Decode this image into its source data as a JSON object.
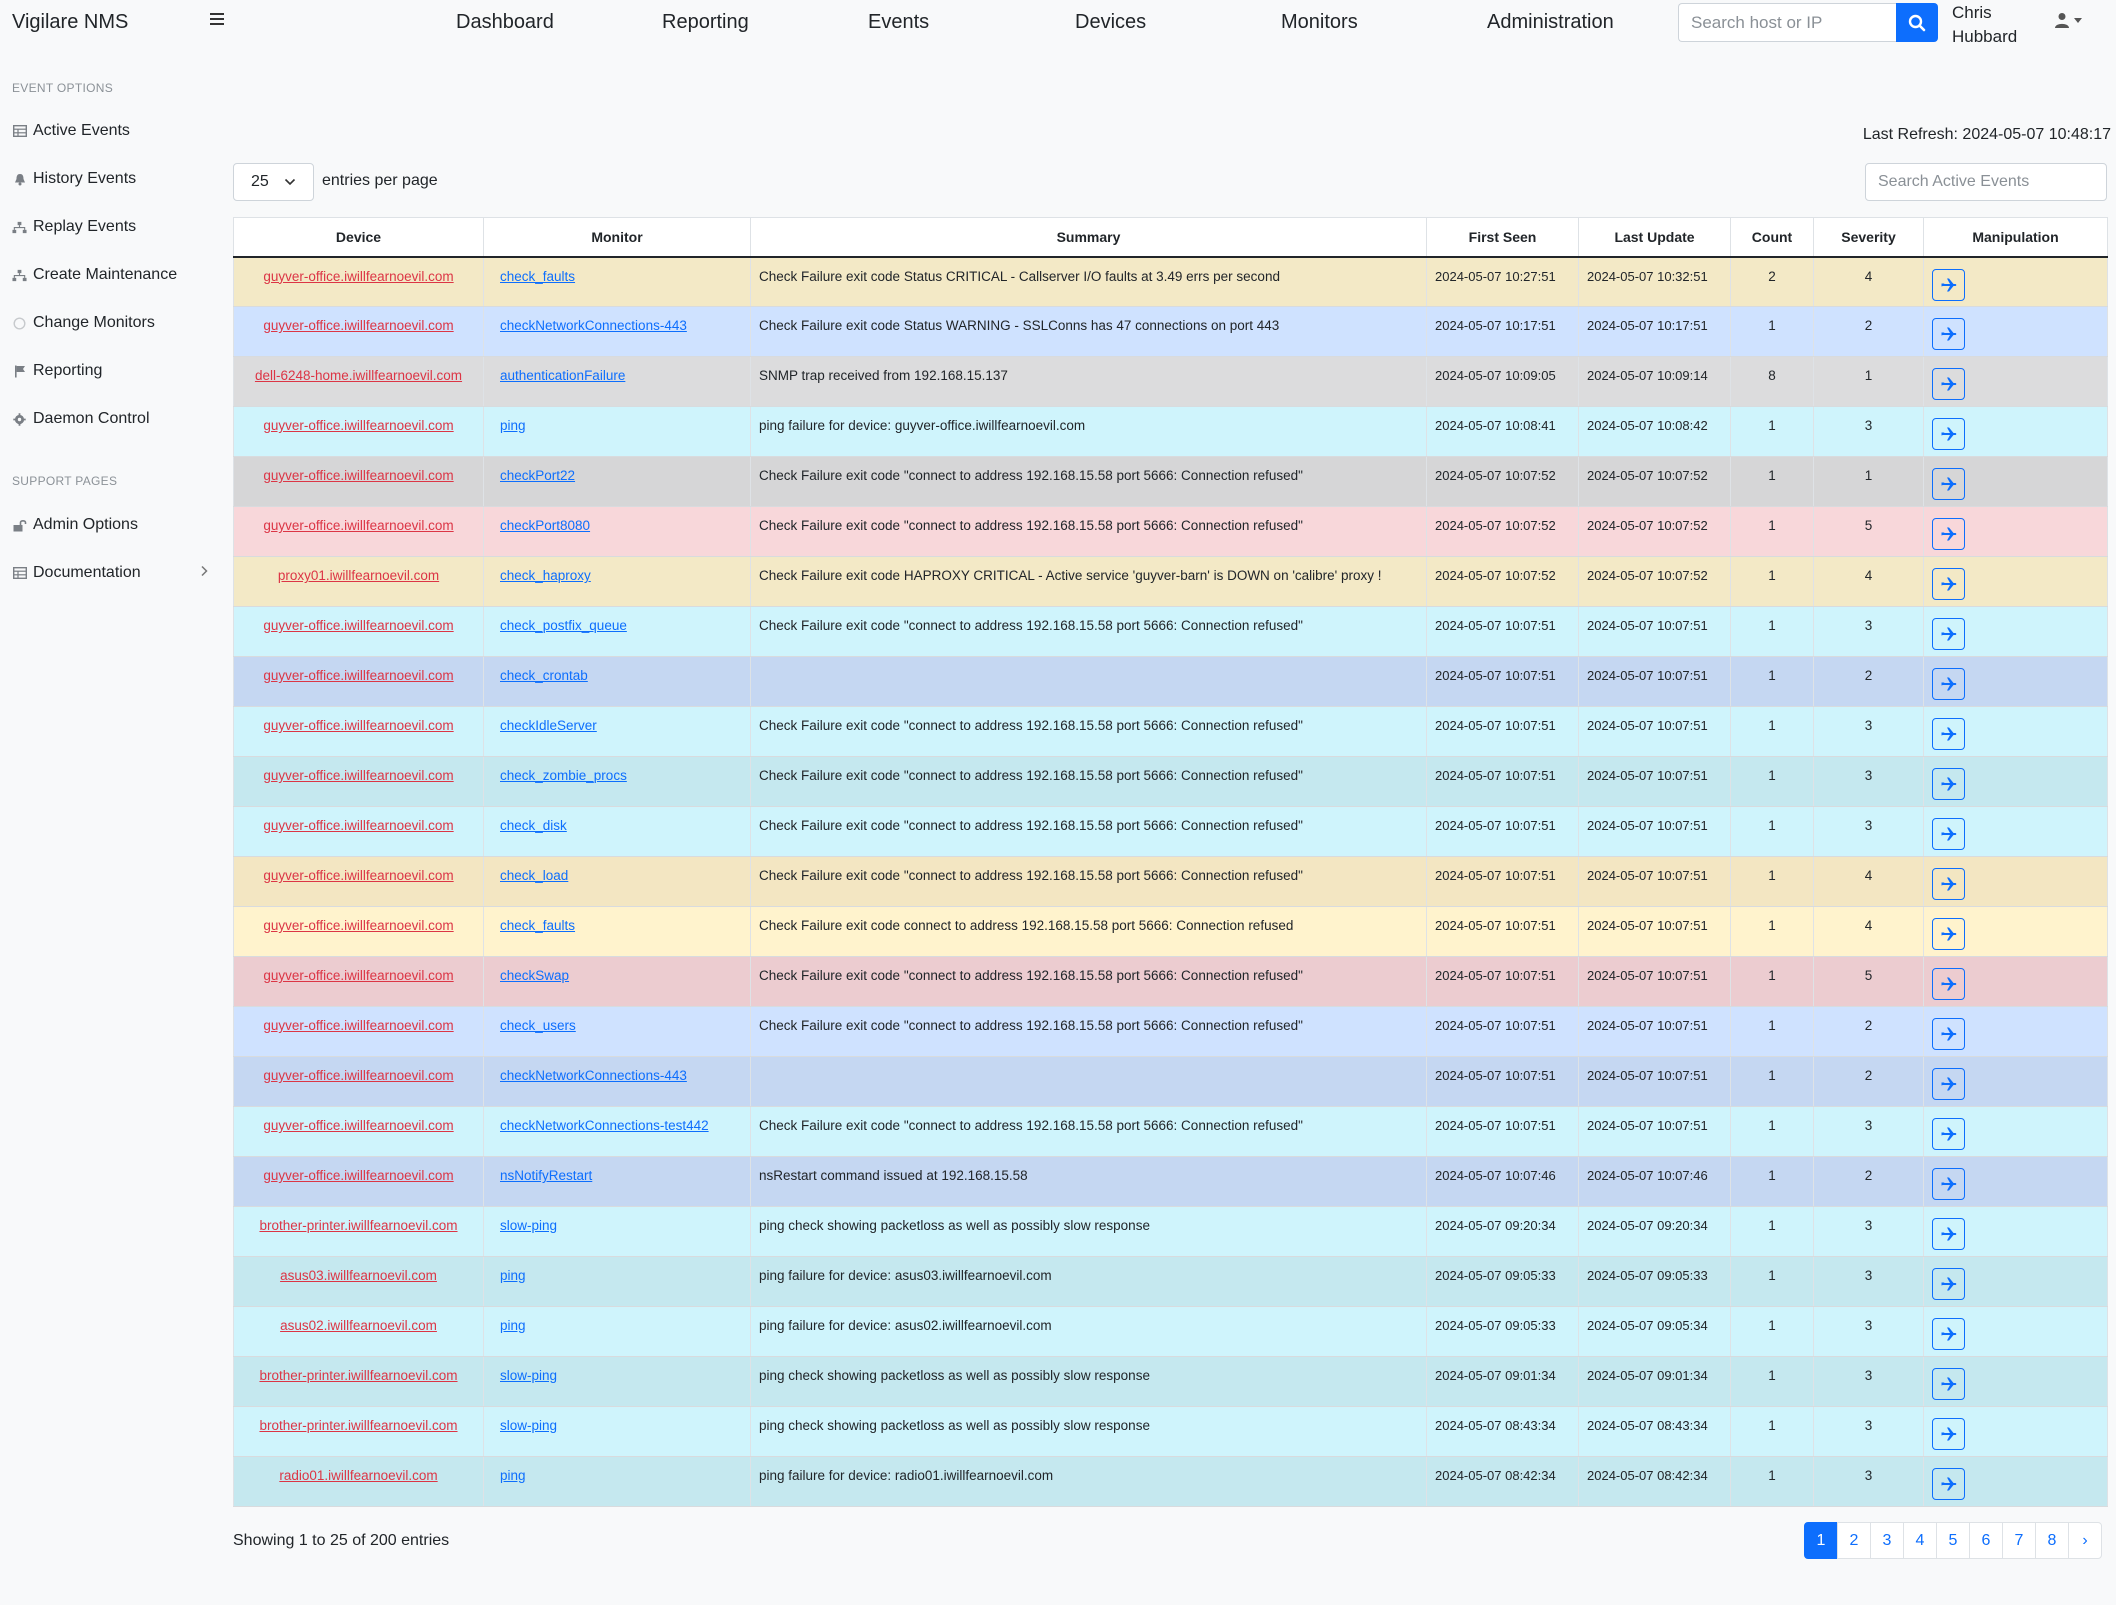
{
  "app": {
    "title": "Vigilare NMS"
  },
  "nav": {
    "items": [
      "Dashboard",
      "Reporting",
      "Events",
      "Devices",
      "Monitors",
      "Administration"
    ],
    "search_placeholder": "Search host or IP",
    "user_name_line1": "Chris",
    "user_name_line2": "Hubbard"
  },
  "sidebar": {
    "event_heading": "EVENT OPTIONS",
    "event_items": [
      {
        "label": "Active Events",
        "icon": "table-icon"
      },
      {
        "label": "History Events",
        "icon": "bell-icon"
      },
      {
        "label": "Replay Events",
        "icon": "sitemap-icon"
      },
      {
        "label": "Create Maintenance",
        "icon": "sitemap-icon"
      },
      {
        "label": "Change Monitors",
        "icon": "circle-icon"
      },
      {
        "label": "Reporting",
        "icon": "flag-icon"
      },
      {
        "label": "Daemon Control",
        "icon": "gear-icon"
      }
    ],
    "support_heading": "SUPPORT PAGES",
    "support_items": [
      {
        "label": "Admin Options",
        "icon": "unlock-icon"
      },
      {
        "label": "Documentation",
        "icon": "table-icon"
      }
    ]
  },
  "main": {
    "last_refresh": "Last Refresh: 2024-05-07 10:48:17",
    "entries_value": "25",
    "entries_label": "entries per page",
    "search_placeholder": "Search Active Events",
    "columns": [
      "Device",
      "Monitor",
      "Summary",
      "First Seen",
      "Last Update",
      "Count",
      "Severity",
      "Manipulation"
    ],
    "rows": [
      {
        "device": "guyver-office.iwillfearnoevil.com",
        "monitor": "check_faults",
        "summary": "Check Failure exit code Status CRITICAL - Callserver I/O faults at 3.49 errs per second",
        "first": "2024-05-07 10:27:51",
        "last": "2024-05-07 10:32:51",
        "count": "2",
        "severity": "4",
        "bg": "#f3e9c6"
      },
      {
        "device": "guyver-office.iwillfearnoevil.com",
        "monitor": "checkNetworkConnections-443",
        "summary": "Check Failure exit code Status WARNING - SSLConns has 47 connections on port 443",
        "first": "2024-05-07 10:17:51",
        "last": "2024-05-07 10:17:51",
        "count": "1",
        "severity": "2",
        "bg": "#cfe2ff"
      },
      {
        "device": "dell-6248-home.iwillfearnoevil.com",
        "monitor": "authenticationFailure",
        "summary": "SNMP trap received from 192.168.15.137",
        "first": "2024-05-07 10:09:05",
        "last": "2024-05-07 10:09:14",
        "count": "8",
        "severity": "1",
        "bg": "#dcdcdd"
      },
      {
        "device": "guyver-office.iwillfearnoevil.com",
        "monitor": "ping",
        "summary": "ping failure for device: guyver-office.iwillfearnoevil.com",
        "first": "2024-05-07 10:08:41",
        "last": "2024-05-07 10:08:42",
        "count": "1",
        "severity": "3",
        "bg": "#cff4fc"
      },
      {
        "device": "guyver-office.iwillfearnoevil.com",
        "monitor": "checkPort22",
        "summary": "Check Failure exit code \"connect to address 192.168.15.58 port 5666: Connection refused\"",
        "first": "2024-05-07 10:07:52",
        "last": "2024-05-07 10:07:52",
        "count": "1",
        "severity": "1",
        "bg": "#d6d6d7"
      },
      {
        "device": "guyver-office.iwillfearnoevil.com",
        "monitor": "checkPort8080",
        "summary": "Check Failure exit code \"connect to address 192.168.15.58 port 5666: Connection refused\"",
        "first": "2024-05-07 10:07:52",
        "last": "2024-05-07 10:07:52",
        "count": "1",
        "severity": "5",
        "bg": "#f8d7da"
      },
      {
        "device": "proxy01.iwillfearnoevil.com",
        "monitor": "check_haproxy",
        "summary": "Check Failure exit code HAPROXY CRITICAL - Active service 'guyver-barn' is DOWN on 'calibre' proxy !",
        "first": "2024-05-07 10:07:52",
        "last": "2024-05-07 10:07:52",
        "count": "1",
        "severity": "4",
        "bg": "#f3e9c6"
      },
      {
        "device": "guyver-office.iwillfearnoevil.com",
        "monitor": "check_postfix_queue",
        "summary": "Check Failure exit code \"connect to address 192.168.15.58 port 5666: Connection refused\"",
        "first": "2024-05-07 10:07:51",
        "last": "2024-05-07 10:07:51",
        "count": "1",
        "severity": "3",
        "bg": "#cff4fc"
      },
      {
        "device": "guyver-office.iwillfearnoevil.com",
        "monitor": "check_crontab",
        "summary": "",
        "first": "2024-05-07 10:07:51",
        "last": "2024-05-07 10:07:51",
        "count": "1",
        "severity": "2",
        "bg": "#c5d7f2"
      },
      {
        "device": "guyver-office.iwillfearnoevil.com",
        "monitor": "checkIdleServer",
        "summary": "Check Failure exit code \"connect to address 192.168.15.58 port 5666: Connection refused\"",
        "first": "2024-05-07 10:07:51",
        "last": "2024-05-07 10:07:51",
        "count": "1",
        "severity": "3",
        "bg": "#cff4fc"
      },
      {
        "device": "guyver-office.iwillfearnoevil.com",
        "monitor": "check_zombie_procs",
        "summary": "Check Failure exit code \"connect to address 192.168.15.58 port 5666: Connection refused\"",
        "first": "2024-05-07 10:07:51",
        "last": "2024-05-07 10:07:51",
        "count": "1",
        "severity": "3",
        "bg": "#c5e8ef"
      },
      {
        "device": "guyver-office.iwillfearnoevil.com",
        "monitor": "check_disk",
        "summary": "Check Failure exit code \"connect to address 192.168.15.58 port 5666: Connection refused\"",
        "first": "2024-05-07 10:07:51",
        "last": "2024-05-07 10:07:51",
        "count": "1",
        "severity": "3",
        "bg": "#cff4fc"
      },
      {
        "device": "guyver-office.iwillfearnoevil.com",
        "monitor": "check_load",
        "summary": "Check Failure exit code \"connect to address 192.168.15.58 port 5666: Connection refused\"",
        "first": "2024-05-07 10:07:51",
        "last": "2024-05-07 10:07:51",
        "count": "1",
        "severity": "4",
        "bg": "#f3e6c2"
      },
      {
        "device": "guyver-office.iwillfearnoevil.com",
        "monitor": "check_faults",
        "summary": "Check Failure exit code connect to address 192.168.15.58 port 5666: Connection refused",
        "first": "2024-05-07 10:07:51",
        "last": "2024-05-07 10:07:51",
        "count": "1",
        "severity": "4",
        "bg": "#fff3cd"
      },
      {
        "device": "guyver-office.iwillfearnoevil.com",
        "monitor": "checkSwap",
        "summary": "Check Failure exit code \"connect to address 192.168.15.58 port 5666: Connection refused\"",
        "first": "2024-05-07 10:07:51",
        "last": "2024-05-07 10:07:51",
        "count": "1",
        "severity": "5",
        "bg": "#ecccd0"
      },
      {
        "device": "guyver-office.iwillfearnoevil.com",
        "monitor": "check_users",
        "summary": "Check Failure exit code \"connect to address 192.168.15.58 port 5666: Connection refused\"",
        "first": "2024-05-07 10:07:51",
        "last": "2024-05-07 10:07:51",
        "count": "1",
        "severity": "2",
        "bg": "#cfe2ff"
      },
      {
        "device": "guyver-office.iwillfearnoevil.com",
        "monitor": "checkNetworkConnections-443",
        "summary": "",
        "first": "2024-05-07 10:07:51",
        "last": "2024-05-07 10:07:51",
        "count": "1",
        "severity": "2",
        "bg": "#c5d7f2"
      },
      {
        "device": "guyver-office.iwillfearnoevil.com",
        "monitor": "checkNetworkConnections-test442",
        "summary": "Check Failure exit code \"connect to address 192.168.15.58 port 5666: Connection refused\"",
        "first": "2024-05-07 10:07:51",
        "last": "2024-05-07 10:07:51",
        "count": "1",
        "severity": "3",
        "bg": "#cff4fc"
      },
      {
        "device": "guyver-office.iwillfearnoevil.com",
        "monitor": "nsNotifyRestart",
        "summary": "nsRestart command issued at 192.168.15.58",
        "first": "2024-05-07 10:07:46",
        "last": "2024-05-07 10:07:46",
        "count": "1",
        "severity": "2",
        "bg": "#c5d7f2"
      },
      {
        "device": "brother-printer.iwillfearnoevil.com",
        "monitor": "slow-ping",
        "summary": "ping check showing packetloss as well as possibly slow response",
        "first": "2024-05-07 09:20:34",
        "last": "2024-05-07 09:20:34",
        "count": "1",
        "severity": "3",
        "bg": "#cff4fc"
      },
      {
        "device": "asus03.iwillfearnoevil.com",
        "monitor": "ping",
        "summary": "ping failure for device: asus03.iwillfearnoevil.com",
        "first": "2024-05-07 09:05:33",
        "last": "2024-05-07 09:05:33",
        "count": "1",
        "severity": "3",
        "bg": "#c5e8ef"
      },
      {
        "device": "asus02.iwillfearnoevil.com",
        "monitor": "ping",
        "summary": "ping failure for device: asus02.iwillfearnoevil.com",
        "first": "2024-05-07 09:05:33",
        "last": "2024-05-07 09:05:34",
        "count": "1",
        "severity": "3",
        "bg": "#cff4fc"
      },
      {
        "device": "brother-printer.iwillfearnoevil.com",
        "monitor": "slow-ping",
        "summary": "ping check showing packetloss as well as possibly slow response",
        "first": "2024-05-07 09:01:34",
        "last": "2024-05-07 09:01:34",
        "count": "1",
        "severity": "3",
        "bg": "#c5e8ef"
      },
      {
        "device": "brother-printer.iwillfearnoevil.com",
        "monitor": "slow-ping",
        "summary": "ping check showing packetloss as well as possibly slow response",
        "first": "2024-05-07 08:43:34",
        "last": "2024-05-07 08:43:34",
        "count": "1",
        "severity": "3",
        "bg": "#cff4fc"
      },
      {
        "device": "radio01.iwillfearnoevil.com",
        "monitor": "ping",
        "summary": "ping failure for device: radio01.iwillfearnoevil.com",
        "first": "2024-05-07 08:42:34",
        "last": "2024-05-07 08:42:34",
        "count": "1",
        "severity": "3",
        "bg": "#c5e8ef"
      }
    ],
    "showing": "Showing 1 to 25 of 200 entries",
    "pages": [
      "1",
      "2",
      "3",
      "4",
      "5",
      "6",
      "7",
      "8",
      "›"
    ],
    "active_page": "1"
  },
  "colors": {
    "accent": "#0d6efd",
    "device_link": "#dc3545"
  }
}
